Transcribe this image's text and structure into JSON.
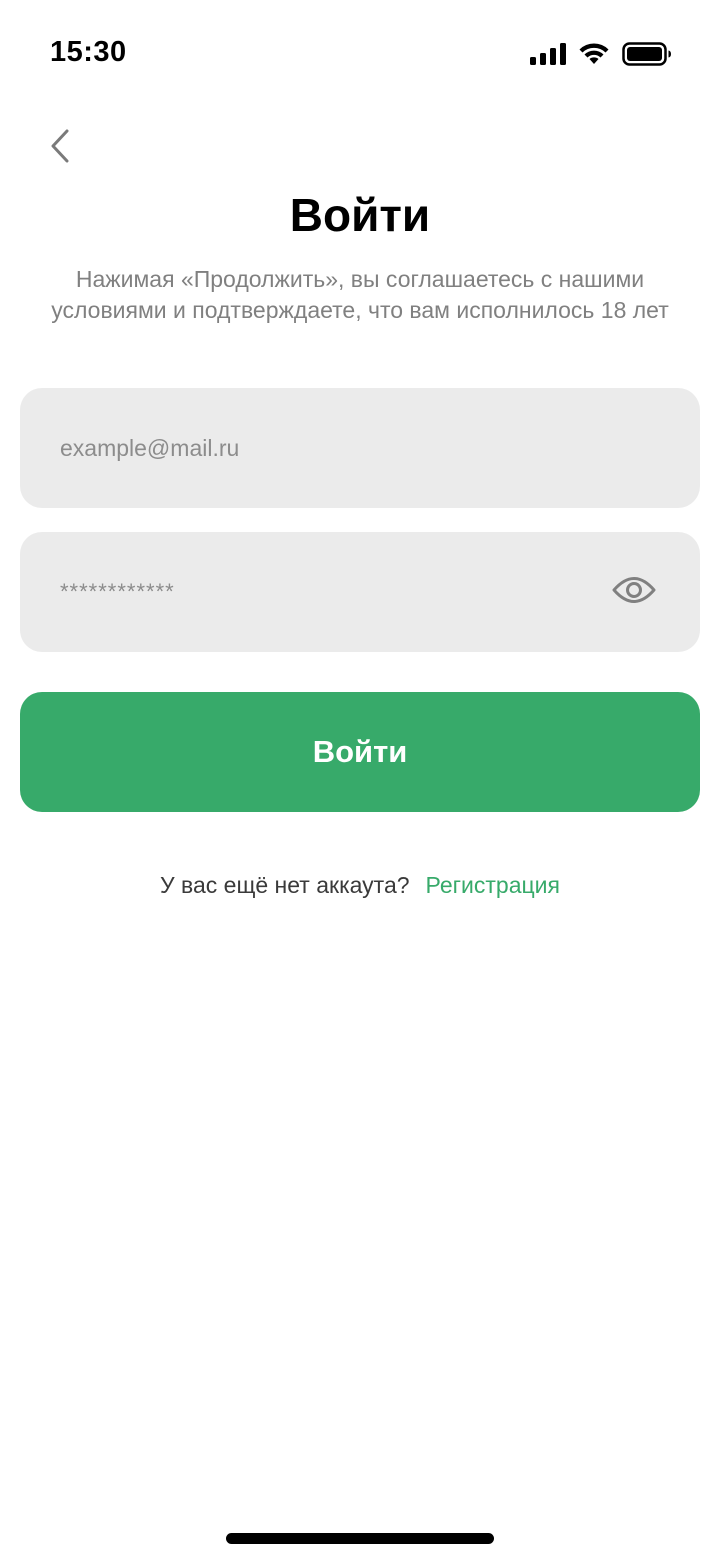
{
  "status_bar": {
    "time": "15:30",
    "icons": [
      "cellular-signal-icon",
      "wifi-icon",
      "battery-icon"
    ]
  },
  "header": {
    "back_icon": "chevron-left-icon",
    "title": "Войти",
    "subtitle_line1": "Нажимая «Продолжить», вы соглашаетесь с нашими",
    "subtitle_line2": "условиями и подтверждаете, что вам исполнилось 18 лет"
  },
  "form": {
    "email": {
      "placeholder": "example@mail.ru",
      "value": ""
    },
    "password": {
      "placeholder": "************",
      "value": "",
      "toggle_icon": "eye-icon"
    },
    "submit_label": "Войти"
  },
  "register": {
    "question": "У вас ещё нет аккаута?",
    "link_label": "Регистрация"
  },
  "colors": {
    "accent": "#37aa6a",
    "field_bg": "#ebebeb",
    "placeholder": "#8c8c8c",
    "subtitle": "#808080"
  }
}
